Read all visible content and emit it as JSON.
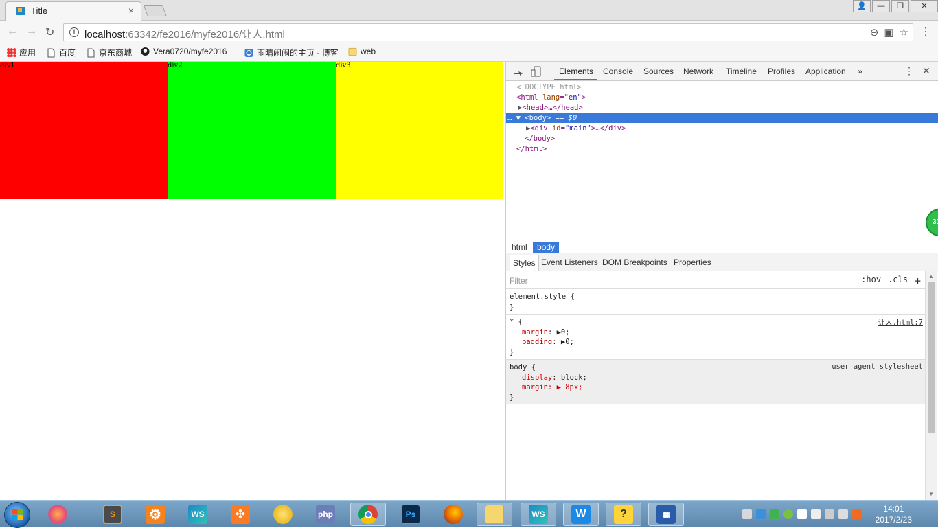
{
  "browser": {
    "tab_title": "Title",
    "tab_close": "×",
    "url_host": "localhost",
    "url_rest": ":63342/fe2016/myfe2016/让人.html",
    "window_buttons": [
      "👤",
      "—",
      "❐",
      "✕"
    ]
  },
  "bookmarks": [
    {
      "label": "应用",
      "icon": "apps-grid-icon"
    },
    {
      "label": "百度",
      "icon": "page-icon"
    },
    {
      "label": "京东商城",
      "icon": "page-icon"
    },
    {
      "label": "Vera0720/myfe2016",
      "icon": "github-icon"
    },
    {
      "label": "雨晴闹闹的主页 - 博客",
      "icon": "blog-icon"
    },
    {
      "label": "web",
      "icon": "folder-icon"
    }
  ],
  "page": {
    "div1": "div1",
    "div2": "div2",
    "div3": "div3",
    "colors": {
      "div1": "#ff0000",
      "div2": "#00ff00",
      "div3": "#ffff00"
    }
  },
  "devtools": {
    "tabs": [
      "Elements",
      "Console",
      "Sources",
      "Network",
      "Timeline",
      "Profiles",
      "Application"
    ],
    "more": "»",
    "dom": {
      "doctype": "<!DOCTYPE html>",
      "html_open_tag": "<html",
      "html_attr": "lang",
      "html_attr_val": "\"en\"",
      "head": "<head>…</head>",
      "body_prefix": "…",
      "body_tag": "<body>",
      "body_eq": " == $0",
      "div_tag": "<div",
      "div_attr": "id",
      "div_attr_val": "\"main\"",
      "div_close": ">…</div>",
      "body_close": "</body>",
      "html_close": "</html>"
    },
    "breadcrumbs": [
      "html",
      "body"
    ],
    "sub_tabs": [
      "Styles",
      "Event Listeners",
      "DOM Breakpoints",
      "Properties"
    ],
    "filter_placeholder": "Filter",
    "filter_hov": ":hov",
    "filter_cls": ".cls",
    "filter_add": "+",
    "rules": {
      "element_style": "element.style {",
      "close": "}",
      "universal_selector": "* {",
      "universal_source": "让人.html:7",
      "margin_prop": "margin",
      "margin_val": "0;",
      "padding_prop": "padding",
      "padding_val": "0;",
      "body_selector": "body {",
      "body_source": "user agent stylesheet",
      "display_prop": "display",
      "display_val": "block;",
      "struck_margin": "margin: ▶ 8px;"
    },
    "badge": "31"
  },
  "taskbar": {
    "time": "14:01",
    "date": "2017/2/23"
  }
}
